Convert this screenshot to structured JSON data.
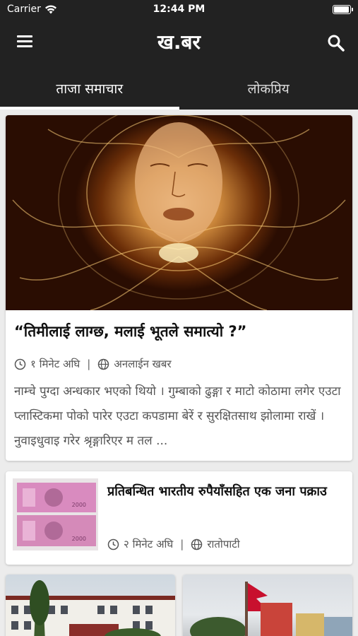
{
  "status": {
    "carrier": "Carrier",
    "time": "12:44 PM"
  },
  "appbar": {
    "title": "ख.बर",
    "menu_icon": "hamburger-menu-icon",
    "search_icon": "search-icon"
  },
  "tabs": [
    {
      "label": "ताजा समाचार",
      "active": true
    },
    {
      "label": "लोकप्रिय",
      "active": false
    }
  ],
  "featured": {
    "headline": "“तिमीलाई लाग्छ, मलाई भूतले समात्यो ?”",
    "time": "१ मिनेट अघि",
    "source": "अनलाईन खबर",
    "excerpt": "नाम्चे पुग्दा अन्धकार भएको थियो । गुम्बाको ढुङ्गा र माटो कोठामा लगेर एउटा प्लास्टिकमा पोको पारेर एउटा कपडामा बेरें र सुरक्षितसाथ झोलामा राखें । नुवाइधुवाइ गरेर श्रृङ्गारिएर म तल ..."
  },
  "small_card": {
    "headline": "प्रतिबन्धित भारतीय रुपैयाँसहित एक जना पक्राउ",
    "time": "२ मिनेट अघि",
    "source": "रातोपाटी"
  },
  "colors": {
    "bar_bg": "#222222",
    "feed_bg": "#ececec",
    "card_bg": "#ffffff"
  }
}
